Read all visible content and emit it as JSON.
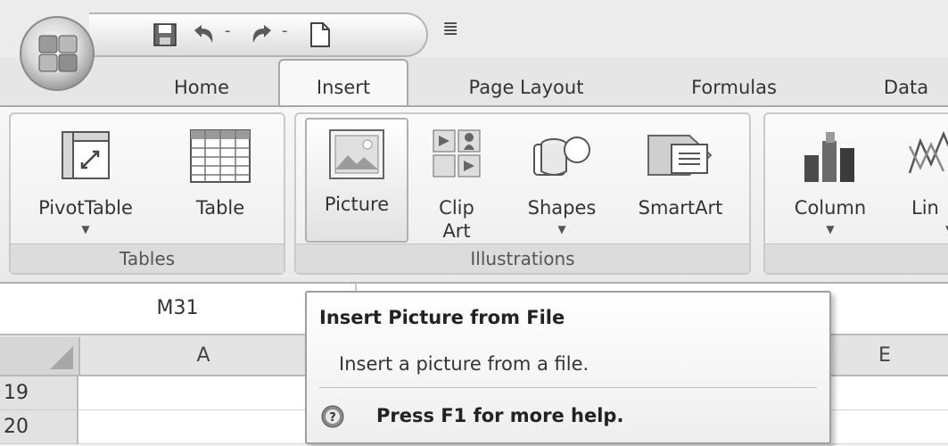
{
  "quick_access": {
    "icons": [
      "save-icon",
      "undo-icon",
      "redo-icon",
      "new-document-icon",
      "customize-dropdown-icon"
    ]
  },
  "tabs": [
    {
      "label": "Home",
      "active": false
    },
    {
      "label": "Insert",
      "active": true
    },
    {
      "label": "Page Layout",
      "active": false
    },
    {
      "label": "Formulas",
      "active": false
    },
    {
      "label": "Data",
      "active": false
    }
  ],
  "ribbon": {
    "groups": [
      {
        "label": "Tables",
        "buttons": [
          {
            "label": "PivotTable",
            "icon": "pivottable-icon",
            "dropdown": true
          },
          {
            "label": "Table",
            "icon": "table-icon",
            "dropdown": false
          }
        ]
      },
      {
        "label": "Illustrations",
        "buttons": [
          {
            "label": "Picture",
            "icon": "picture-icon",
            "dropdown": false,
            "highlighted": true
          },
          {
            "label_line1": "Clip",
            "label_line2": "Art",
            "icon": "clip-art-icon",
            "dropdown": false
          },
          {
            "label": "Shapes",
            "icon": "shapes-icon",
            "dropdown": true
          },
          {
            "label": "SmartArt",
            "icon": "smartart-icon",
            "dropdown": false
          }
        ]
      },
      {
        "label": "",
        "buttons": [
          {
            "label": "Column",
            "icon": "column-chart-icon",
            "dropdown": true
          },
          {
            "label": "Lin",
            "icon": "line-chart-icon",
            "dropdown": true
          }
        ]
      }
    ]
  },
  "name_box": {
    "value": "M31"
  },
  "sheet": {
    "column_headers": [
      "A",
      "E"
    ],
    "rows": [
      "19",
      "20"
    ]
  },
  "tooltip": {
    "title": "Insert Picture from File",
    "description": "Insert a picture from a file.",
    "help": "Press F1 for more help.",
    "help_icon": "help-icon"
  },
  "colors": {
    "background": "#f4f4f4",
    "tooltip_border": "#9e9e9e"
  }
}
